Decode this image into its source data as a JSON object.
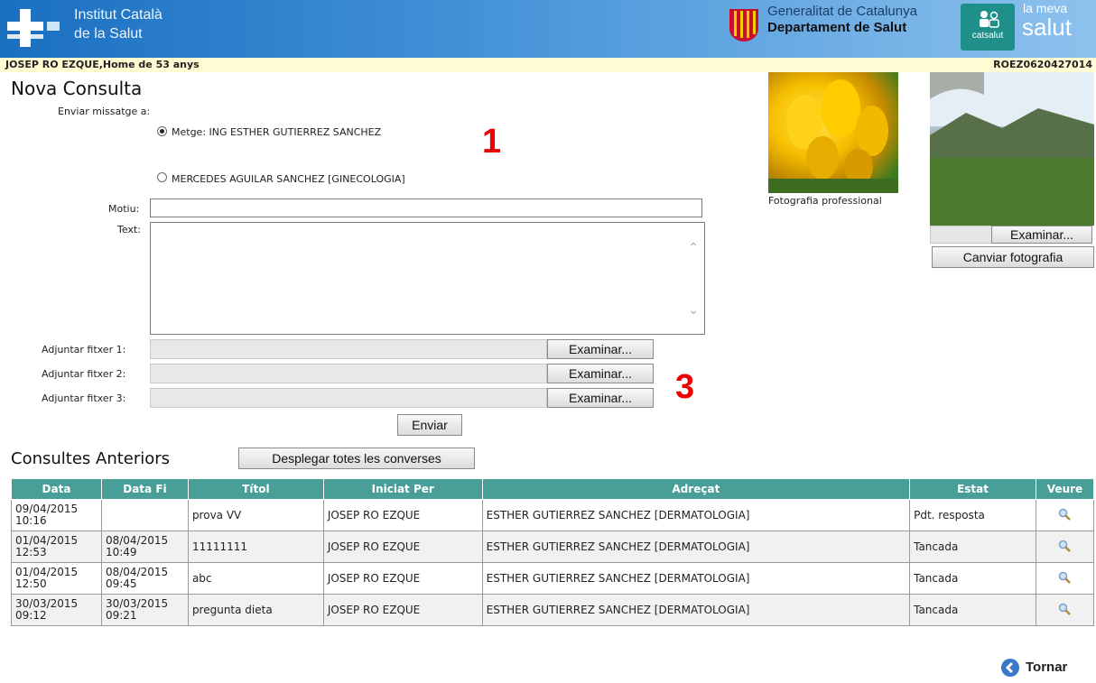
{
  "header": {
    "ics_title_line1": "Institut Català",
    "ics_title_line2": "de la Salut",
    "gen_line1": "Generalitat de Catalunya",
    "gen_line2": "Departament de Salut",
    "catsalut": "catsalut",
    "lameva": "la meva",
    "salut": "salut"
  },
  "patient": {
    "name": "JOSEP RO EZQUE,Home de 53 anys",
    "code": "ROEZ0620427014"
  },
  "form": {
    "title": "Nova Consulta",
    "send_to_label": "Enviar missatge a:",
    "recipients": [
      {
        "label": "Metge: ING ESTHER GUTIERREZ SANCHEZ",
        "selected": true
      },
      {
        "label": "MERCEDES AGUILAR SANCHEZ [GINECOLOGIA]",
        "selected": false
      }
    ],
    "motiu_label": "Motiu:",
    "motiu_value": "",
    "text_label": "Text:",
    "text_value": "",
    "attachments": [
      {
        "label": "Adjuntar fitxer 1:",
        "button": "Examinar..."
      },
      {
        "label": "Adjuntar fitxer 2:",
        "button": "Examinar..."
      },
      {
        "label": "Adjuntar fitxer 3:",
        "button": "Examinar..."
      }
    ],
    "send_button": "Enviar",
    "marker_1": "1",
    "marker_3": "3"
  },
  "photos": {
    "professional_caption": "Fotografia professional",
    "browse_button": "Examinar...",
    "change_button": "Canviar fotografia"
  },
  "history": {
    "title": "Consultes Anteriors",
    "expand_button": "Desplegar totes les converses",
    "columns": [
      "Data",
      "Data Fi",
      "Títol",
      "Iniciat Per",
      "Adreçat",
      "Estat",
      "Veure"
    ],
    "rows": [
      {
        "date": "09/04/2015",
        "time": "10:16",
        "end_date": "",
        "end_time": "",
        "title": "prova VV",
        "initiator": "JOSEP RO EZQUE",
        "addressee": "ESTHER GUTIERREZ SANCHEZ [DERMATOLOGIA]",
        "status": "Pdt. resposta"
      },
      {
        "date": "01/04/2015",
        "time": "12:53",
        "end_date": "08/04/2015",
        "end_time": "10:49",
        "title": "11111111",
        "initiator": "JOSEP RO EZQUE",
        "addressee": "ESTHER GUTIERREZ SANCHEZ [DERMATOLOGIA]",
        "status": "Tancada"
      },
      {
        "date": "01/04/2015",
        "time": "12:50",
        "end_date": "08/04/2015",
        "end_time": "09:45",
        "title": "abc",
        "initiator": "JOSEP RO EZQUE",
        "addressee": "ESTHER GUTIERREZ SANCHEZ [DERMATOLOGIA]",
        "status": "Tancada"
      },
      {
        "date": "30/03/2015",
        "time": "09:12",
        "end_date": "30/03/2015",
        "end_time": "09:21",
        "title": "pregunta dieta",
        "initiator": "JOSEP RO EZQUE",
        "addressee": "ESTHER GUTIERREZ SANCHEZ [DERMATOLOGIA]",
        "status": "Tancada"
      }
    ]
  },
  "footer": {
    "back_label": "Tornar"
  },
  "colors": {
    "header_blue": "#1a6fc0",
    "table_header": "#4a9e98",
    "patient_bar": "#fffbd2",
    "marker_red": "#e00000"
  }
}
